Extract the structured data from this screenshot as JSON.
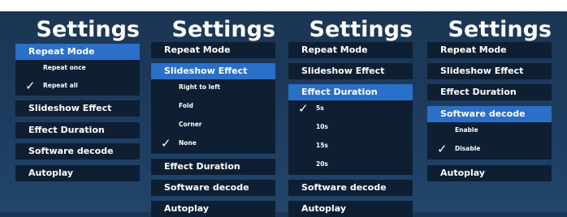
{
  "panels": [
    {
      "title": "Settings",
      "items": [
        {
          "label": "Repeat Mode",
          "active": true
        },
        {
          "label": "Slideshow Effect"
        },
        {
          "label": "Effect Duration"
        },
        {
          "label": "Software decode"
        },
        {
          "label": "Autoplay"
        }
      ],
      "submenu": {
        "options": [
          {
            "label": "Repeat once",
            "checked": false
          },
          {
            "label": "Repeat all",
            "checked": true
          }
        ]
      }
    },
    {
      "title": "Settings",
      "items": [
        {
          "label": "Repeat Mode"
        },
        {
          "label": "Slideshow Effect",
          "active": true
        },
        {
          "label": "Effect Duration"
        },
        {
          "label": "Software decode"
        },
        {
          "label": "Autoplay"
        }
      ],
      "submenu": {
        "options": [
          {
            "label": "Right to left",
            "checked": false
          },
          {
            "label": "Fold",
            "checked": false
          },
          {
            "label": "Corner",
            "checked": false
          },
          {
            "label": "None",
            "checked": true
          }
        ]
      }
    },
    {
      "title": "Settings",
      "items": [
        {
          "label": "Repeat Mode"
        },
        {
          "label": "Slideshow Effect"
        },
        {
          "label": "Effect Duration",
          "active": true
        },
        {
          "label": "Software decode"
        },
        {
          "label": "Autoplay"
        }
      ],
      "submenu": {
        "options": [
          {
            "label": "5s",
            "checked": true
          },
          {
            "label": "10s",
            "checked": false
          },
          {
            "label": "15s",
            "checked": false
          },
          {
            "label": "20s",
            "checked": false
          }
        ]
      }
    },
    {
      "title": "Settings",
      "items": [
        {
          "label": "Repeat Mode"
        },
        {
          "label": "Slideshow Effect"
        },
        {
          "label": "Effect Duration"
        },
        {
          "label": "Software decode",
          "active": true
        },
        {
          "label": "Autoplay"
        }
      ],
      "submenu": {
        "options": [
          {
            "label": "Enable",
            "checked": false
          },
          {
            "label": "Disable",
            "checked": true
          }
        ]
      }
    }
  ],
  "checkmark_glyph": "✓",
  "colors": {
    "background": "#1d3a5c",
    "item_background": "#0e1f33",
    "active_item": "#2a6fc8",
    "text": "#ffffff"
  }
}
